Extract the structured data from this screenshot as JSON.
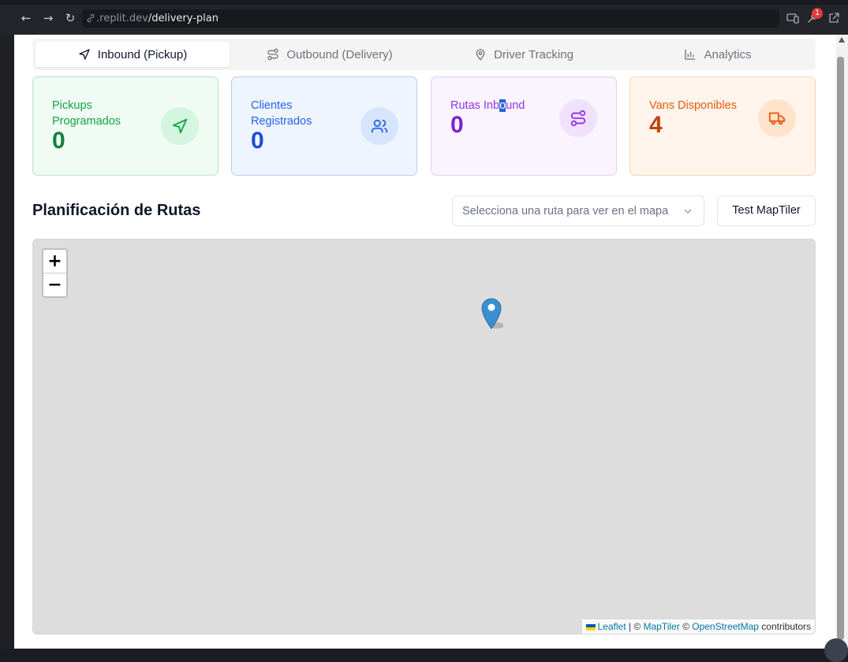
{
  "browser": {
    "url_host": ".replit.dev",
    "url_path": "/delivery-plan",
    "notification_count": "1"
  },
  "tabs": [
    {
      "label": "Inbound (Pickup)",
      "icon": "send-icon",
      "active": true
    },
    {
      "label": "Outbound (Delivery)",
      "icon": "route-icon",
      "active": false
    },
    {
      "label": "Driver Tracking",
      "icon": "map-pin-icon",
      "active": false
    },
    {
      "label": "Analytics",
      "icon": "bar-chart-icon",
      "active": false
    }
  ],
  "stats": [
    {
      "label": "Pickups Programados",
      "value": "0",
      "icon": "send-icon",
      "color": "#15803d"
    },
    {
      "label": "Clientes Registrados",
      "value": "0",
      "icon": "users-icon",
      "color": "#1d4ed8"
    },
    {
      "label_pre": "Rutas Inb",
      "label_hl": "o",
      "label_post": "und",
      "value": "0",
      "icon": "route-icon",
      "color": "#7e22ce"
    },
    {
      "label": "Vans Disponibles",
      "value": "4",
      "icon": "truck-icon",
      "color": "#c2410c"
    }
  ],
  "planning": {
    "title": "Planificación de Rutas",
    "select_placeholder": "Selecciona una ruta para ver en el mapa",
    "test_button": "Test MapTiler"
  },
  "map": {
    "zoom_in": "+",
    "zoom_out": "−",
    "attribution": {
      "leaflet": "Leaflet",
      "sep1": " | © ",
      "maptiler": "MapTiler",
      "sep2": " © ",
      "osm": "OpenStreetMap",
      "tail": " contributors"
    },
    "marker_color": "#3a8fd0"
  }
}
